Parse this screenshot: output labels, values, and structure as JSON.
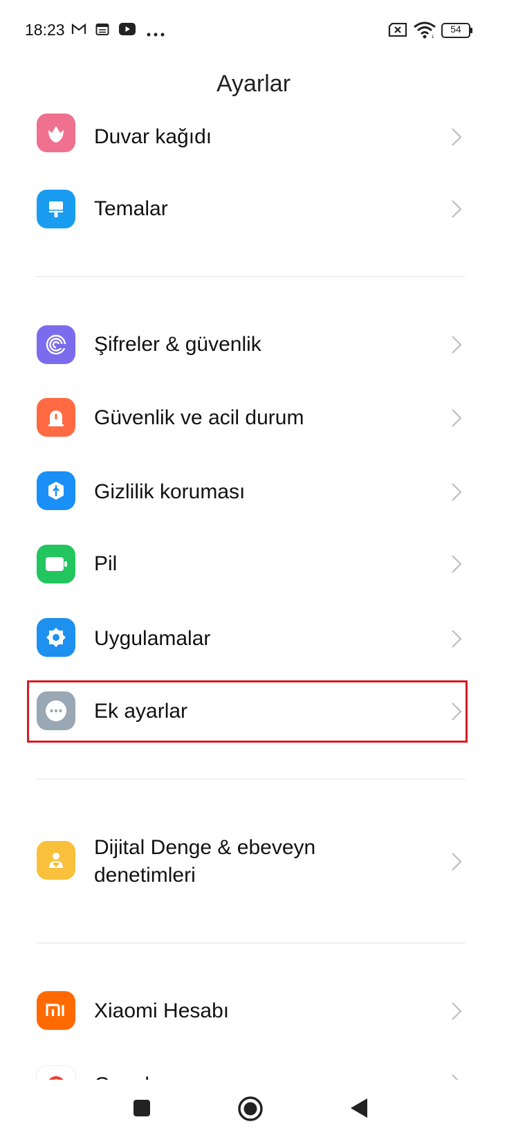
{
  "status_bar": {
    "time": "18:23",
    "battery": "54",
    "icons": [
      "gmail-icon",
      "calendar-icon",
      "youtube-icon",
      "more-dots-icon",
      "no-sim-icon",
      "wifi-icon",
      "battery-icon"
    ]
  },
  "header": {
    "title": "Ayarlar"
  },
  "settings": {
    "items": [
      {
        "label": "Duvar kağıdı",
        "icon": "wallpaper-icon",
        "color": "#f0718f"
      },
      {
        "label": "Temalar",
        "icon": "themes-icon",
        "color": "#1a9cf0"
      },
      {
        "label": "Şifreler & güvenlik",
        "icon": "fingerprint-icon",
        "color": "#7a6cec"
      },
      {
        "label": "Güvenlik ve acil durum",
        "icon": "emergency-icon",
        "color": "#ff6a42"
      },
      {
        "label": "Gizlilik koruması",
        "icon": "privacy-icon",
        "color": "#1a8ff5"
      },
      {
        "label": "Pil",
        "icon": "battery-setting-icon",
        "color": "#22c55e"
      },
      {
        "label": "Uygulamalar",
        "icon": "gear-icon",
        "color": "#1e90f0"
      },
      {
        "label": "Ek ayarlar",
        "icon": "more-settings-icon",
        "color": "#9aa7b4"
      },
      {
        "label": "Dijital Denge & ebeveyn denetimleri",
        "icon": "digital-wellbeing-icon",
        "color": "#f9c03c"
      },
      {
        "label": "Xiaomi Hesabı",
        "icon": "mi-icon",
        "color": "#ff6a00"
      },
      {
        "label": "Google",
        "icon": "google-icon",
        "color": "#ffffff"
      }
    ]
  },
  "highlight_color": "#d81b22",
  "navbar": {
    "buttons": [
      "recents-button",
      "home-button",
      "back-button"
    ]
  }
}
